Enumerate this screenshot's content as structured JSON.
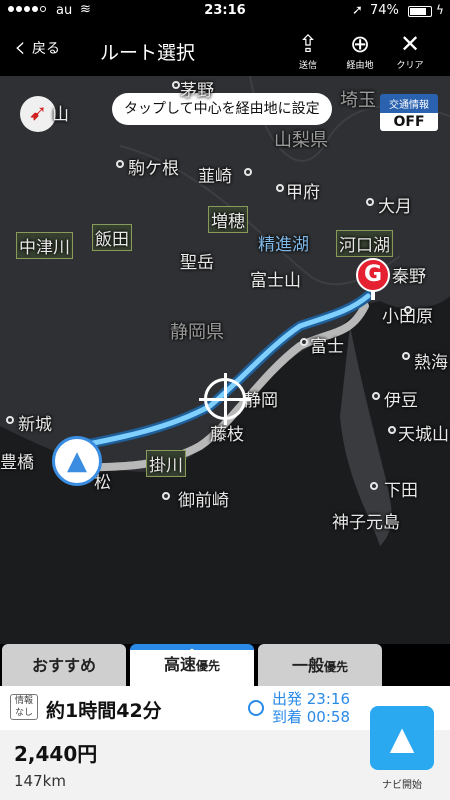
{
  "status": {
    "carrier": "au",
    "time": "23:16",
    "battery": "74%"
  },
  "header": {
    "back_label": "戻る",
    "title": "ルート選択",
    "actions": [
      {
        "label": "送信"
      },
      {
        "label": "経由地"
      },
      {
        "label": "クリア"
      }
    ]
  },
  "map": {
    "tooltip": "タップして中心を経由地に設定",
    "traffic": {
      "label": "交通情報",
      "value": "OFF"
    },
    "goal_label": "G",
    "places": {
      "kofu_top": "茅野",
      "yamanashi": "山梨県",
      "saitama": "埼玉",
      "komagane": "駒ケ根",
      "nirasaki": "韮崎",
      "kofu": "甲府",
      "otsuki": "大月",
      "nakatsugawa": "中津川",
      "iida": "飯田",
      "masuho": "増穂",
      "shojinko": "精進湖",
      "kawaguchiko": "河口湖",
      "hijiridake": "聖岳",
      "fujisan": "富士山",
      "hadano": "秦野",
      "shizuokaken": "静岡県",
      "odawara": "小田原",
      "fuji": "富士",
      "atami": "熱海",
      "shizuoka": "静岡",
      "izu": "伊豆",
      "shinshiro": "新城",
      "fujieda": "藤枝",
      "amagisan": "天城山",
      "toyohashi": "豊橋",
      "kakegawa": "掛川",
      "hamamatsu": "松",
      "shimoda": "下田",
      "omaezaki": "御前崎",
      "mikomoto": "神子元島",
      "yama": "山"
    }
  },
  "tabs": [
    {
      "label": "おすすめ",
      "suffix": ""
    },
    {
      "label": "高速",
      "suffix": "優先"
    },
    {
      "label": "一般",
      "suffix": "優先"
    }
  ],
  "route": {
    "badge": "情報なし",
    "duration": "約1時間42分",
    "depart": "出発 23:16",
    "arrive": "到着 00:58",
    "toll": "2,440円",
    "distance": "147km",
    "navi_label": "ナビ開始"
  },
  "colors": {
    "accent": "#2a8ae8",
    "route": "#7fd0ff",
    "goal": "#e52030"
  }
}
